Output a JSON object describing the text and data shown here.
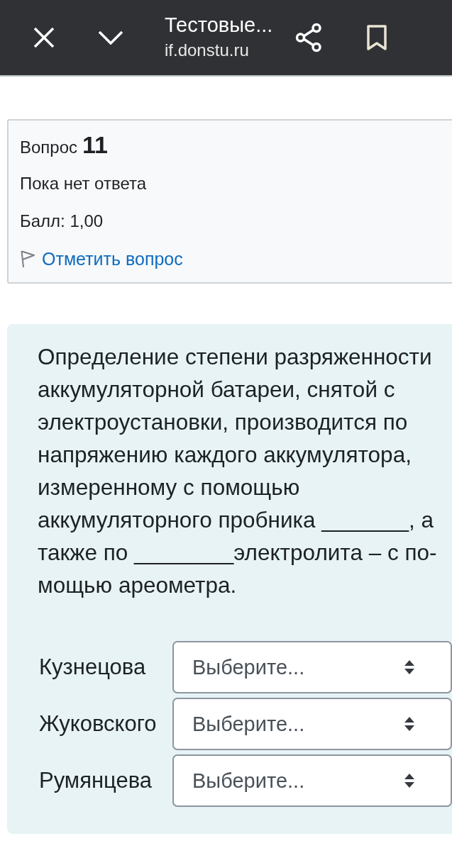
{
  "browser_bar": {
    "title": "Тестовые...",
    "url": "if.donstu.ru"
  },
  "question_info": {
    "label": "Вопрос",
    "number": "11",
    "status": "Пока нет ответа",
    "grade": "Балл: 1,00",
    "flag_link": "Отметить вопрос"
  },
  "question": {
    "text": "Определение степени разряженности аккумуляторной батареи, снятой с электроустановки, производится по напряжению каждого аккумулятора, измеренному с помощью аккумуляторного пробника _______, а также по ________электролита – с по-мощью ареометра.",
    "answers": [
      {
        "label": "Кузнецова",
        "value": "Выберите..."
      },
      {
        "label": "Жуковского",
        "value": "Выберите..."
      },
      {
        "label": "Румянцева",
        "value": "Выберите..."
      }
    ]
  }
}
